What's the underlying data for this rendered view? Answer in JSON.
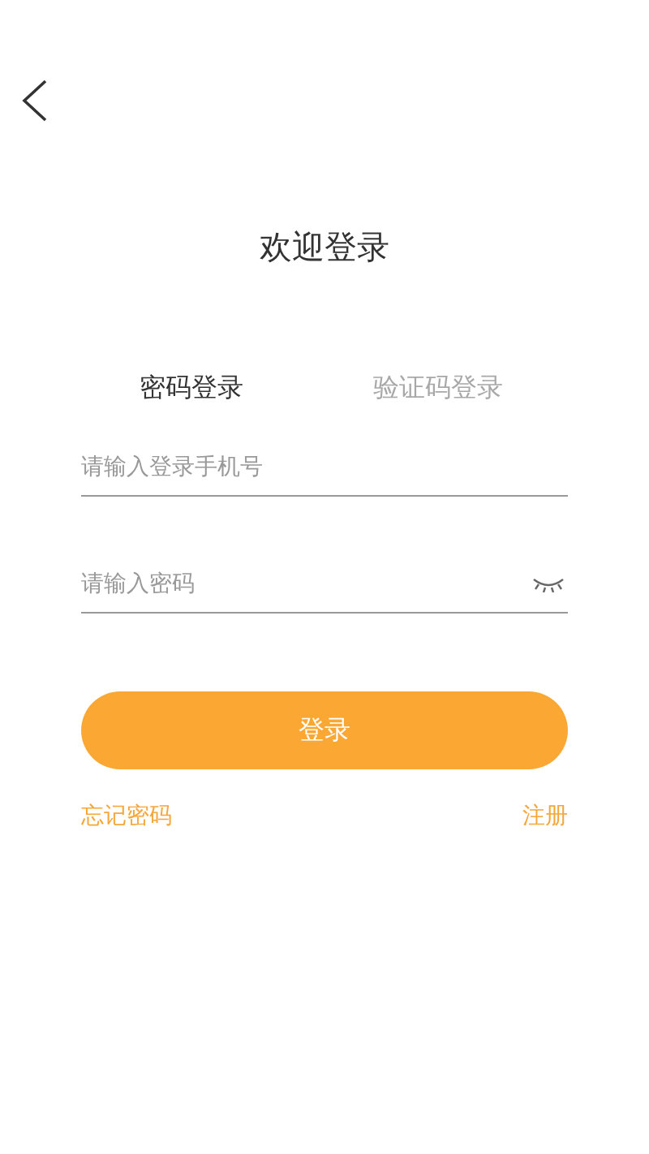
{
  "title": "欢迎登录",
  "tabs": [
    {
      "label": "密码登录",
      "selected": true
    },
    {
      "label": "验证码登录",
      "selected": false
    }
  ],
  "fields": [
    {
      "kind": "phone",
      "placeholder": "请输入登录手机号"
    },
    {
      "kind": "password",
      "placeholder": "请输入密码"
    }
  ],
  "login_button": "登录",
  "links": {
    "forgot": "忘记密码",
    "register": "注册"
  }
}
